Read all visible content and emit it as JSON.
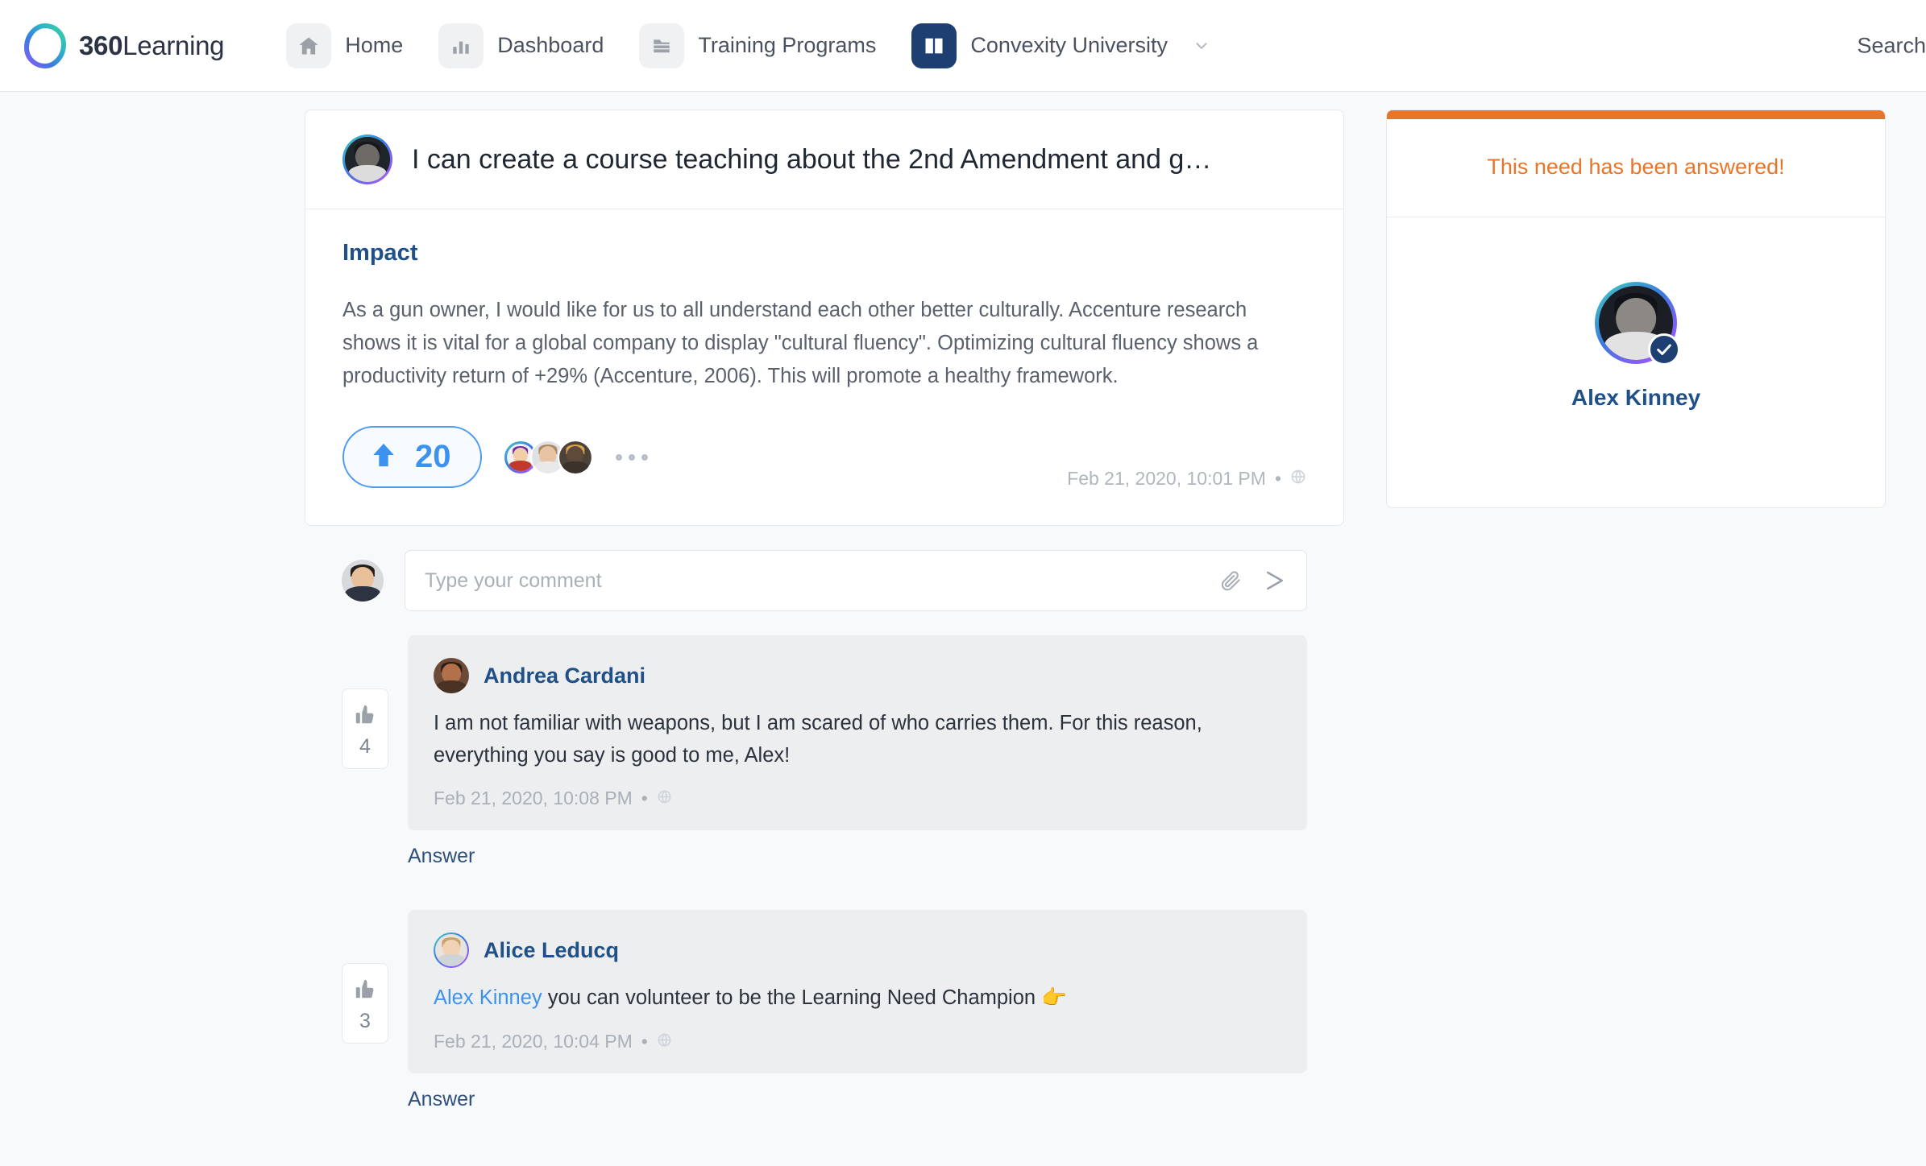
{
  "brand": {
    "bold": "360",
    "light": "Learning"
  },
  "nav": {
    "items": [
      {
        "label": "Home",
        "icon": "home-icon",
        "active": false
      },
      {
        "label": "Dashboard",
        "icon": "bar-chart-icon",
        "active": false
      },
      {
        "label": "Training Programs",
        "icon": "folder-icon",
        "active": false
      },
      {
        "label": "Convexity University",
        "icon": "book-icon",
        "active": true
      }
    ],
    "search_label": "Search"
  },
  "need": {
    "title": "I can create a course teaching about the 2nd Amendment and g…",
    "author_avatar": "alex-kinney-avatar",
    "section_heading": "Impact",
    "body": "As a gun owner, I would like for us to all understand each other better culturally. Accenture research shows it is vital for a global company to display \"cultural fluency\". Optimizing cultural fluency shows a productivity return of +29% (Accenture, 2006). This will promote a healthy framework.",
    "upvote_count": "20",
    "upvote_icon": "up-arrow-icon",
    "more_icon": "ellipsis-icon",
    "timestamp": "Feb 21, 2020, 10:01 PM",
    "timestamp_separator": "•",
    "timestamp_icon": "globe-icon",
    "voter_avatars": [
      "voter-avatar-1",
      "voter-avatar-2",
      "voter-avatar-3"
    ]
  },
  "comment_box": {
    "placeholder": "Type your comment",
    "value": "",
    "attach_icon": "paperclip-icon",
    "send_icon": "send-icon",
    "avatar": "current-user-avatar"
  },
  "comments": [
    {
      "author": "Andrea Cardani",
      "text": "I am not familiar with weapons, but I am scared of who carries them. For this reason, everything you say is good to me, Alex!",
      "mention": "",
      "emoji": "",
      "timestamp": "Feb 21, 2020, 10:08 PM",
      "timestamp_separator": "•",
      "timestamp_icon": "globe-icon",
      "likes": "4",
      "like_icon": "thumbs-up-icon",
      "answer_label": "Answer"
    },
    {
      "author": "Alice Leducq",
      "mention": "Alex Kinney",
      "text": " you can volunteer to be the Learning Need Champion ",
      "emoji": "👉",
      "timestamp": "Feb 21, 2020, 10:04 PM",
      "timestamp_separator": "•",
      "timestamp_icon": "globe-icon",
      "likes": "3",
      "like_icon": "thumbs-up-icon",
      "answer_label": "Answer"
    }
  ],
  "sidebar": {
    "banner": "This need has been answered!",
    "champion_name": "Alex Kinney",
    "champion_avatar": "alex-kinney-avatar",
    "verified_icon": "check-badge-icon"
  },
  "colors": {
    "accent_blue": "#3d92f0",
    "brand_navy": "#1d3f72",
    "orange": "#e8762a",
    "link_blue": "#1f5087",
    "page_bg": "#f7f9fb"
  }
}
